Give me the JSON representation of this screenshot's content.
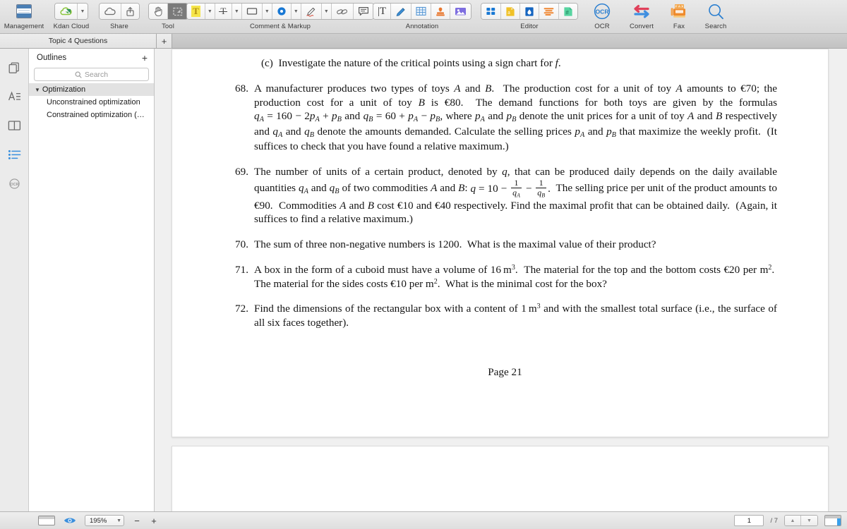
{
  "toolbar": {
    "groups": [
      {
        "label": "Management",
        "icons": [
          "document-management-icon"
        ]
      },
      {
        "label": "Kdan Cloud",
        "icons": [
          "kdan-cloud-icon",
          "chevron-down-icon"
        ]
      },
      {
        "label": "Share",
        "icons": [
          "cloud-icon",
          "share-upload-icon"
        ]
      },
      {
        "label": "Tool",
        "icons": [
          "hand-tool-icon",
          "select-area-icon"
        ]
      },
      {
        "label": "Comment & Markup",
        "icons": [
          "highlight-text-icon",
          "chevron-down-icon",
          "strikethrough-icon",
          "chevron-down-icon",
          "shape-rectangle-icon",
          "chevron-down-icon",
          "sticky-note-icon",
          "chevron-down-icon",
          "pencil-draw-icon",
          "chevron-down-icon",
          "eraser-icon",
          "text-comment-icon"
        ]
      },
      {
        "label": "Annotation",
        "icons": [
          "text-box-icon",
          "signature-icon",
          "table-icon",
          "stamp-icon",
          "image-icon"
        ]
      },
      {
        "label": "Editor",
        "icons": [
          "layout-blocks-icon",
          "edit-text-icon",
          "edit-image-icon",
          "paragraph-icon",
          "page-number-icon"
        ]
      },
      {
        "label": "OCR",
        "icons": [
          "ocr-icon"
        ]
      },
      {
        "label": "Convert",
        "icons": [
          "convert-icon"
        ]
      },
      {
        "label": "Fax",
        "icons": [
          "fax-icon"
        ]
      },
      {
        "label": "Search",
        "icons": [
          "search-icon"
        ]
      }
    ]
  },
  "tabs": {
    "items": [
      {
        "label": "Topic 4 Questions",
        "active": true
      }
    ],
    "add_label": "+"
  },
  "rail": {
    "items": [
      {
        "name": "thumbnails-icon",
        "active": false
      },
      {
        "name": "annotations-icon",
        "active": false
      },
      {
        "name": "bookmarks-icon",
        "active": false
      },
      {
        "name": "outlines-icon",
        "active": true
      },
      {
        "name": "ocr-panel-icon",
        "active": false
      }
    ]
  },
  "sidebar": {
    "title": "Outlines",
    "add_label": "+",
    "search": {
      "placeholder": "Search",
      "value": "",
      "icon": "search-icon"
    },
    "tree": [
      {
        "label": "Optimization",
        "level": 0,
        "expanded": true,
        "selected": true
      },
      {
        "label": "Unconstrained optimization",
        "level": 1,
        "expanded": false,
        "selected": false
      },
      {
        "label": "Constrained optimization (…",
        "level": 1,
        "expanded": false,
        "selected": false
      }
    ]
  },
  "document": {
    "subitem_c": "(c)  Investigate the nature of the critical points using a sign chart for f.",
    "problems": [
      {
        "number": "68.",
        "text": "A manufacturer produces two types of toys A and B.  The production cost for a unit of toy A amounts to €70; the production cost for a unit of toy B is €80.  The demand functions for both toys are given by the formulas qA = 160 − 2pA + pB and qB = 60 + pA − pB, where pA and pB denote the unit prices for a unit of toy A and B respectively and qA and qB denote the amounts demanded.  Calculate the selling prices pA and pB that maximize the weekly profit.  (It suffices to check that you have found a relative maximum.)"
      },
      {
        "number": "69.",
        "text": "The number of units of a certain product, denoted by q, that can be produced daily depends on the daily available quantities qA and qB of two commodities A and B: q = 10 − 1/qA − 1/qB.  The selling price per unit of the product amounts to €90.  Commodities A and B cost €10 and €40 respectively.  Find the maximal profit that can be obtained daily.  (Again, it suffices to find a relative maximum.)"
      },
      {
        "number": "70.",
        "text": "The sum of three non-negative numbers is 1200.  What is the maximal value of their product?"
      },
      {
        "number": "71.",
        "text": "A box in the form of a cuboid must have a volume of 16 m3.  The material for the top and the bottom costs €20 per m2.  The material for the sides costs €10 per m2.  What is the minimal cost for the box?"
      },
      {
        "number": "72.",
        "text": "Find the dimensions of the rectangular box with a content of 1 m3 and with the smallest total surface (i.e., the surface of all six faces together)."
      }
    ],
    "footer": "Page 21"
  },
  "status": {
    "view_mode_icon": "single-page-view-icon",
    "eye_icon": "visibility-icon",
    "zoom": {
      "value": "195%",
      "zoom_out": "−",
      "zoom_in": "+"
    },
    "page_current": "1",
    "page_total": "/ 7",
    "prev_label": "▲",
    "next_label": "▼",
    "panel_toggle_icon": "toggle-panel-icon"
  },
  "colors": {
    "accent_blue": "#1878d4",
    "toolbar_bg": "#e2e2e2",
    "selected_gray": "#7a7a7a",
    "highlight_yellow": "#f5e54a",
    "orange": "#f0882a"
  }
}
